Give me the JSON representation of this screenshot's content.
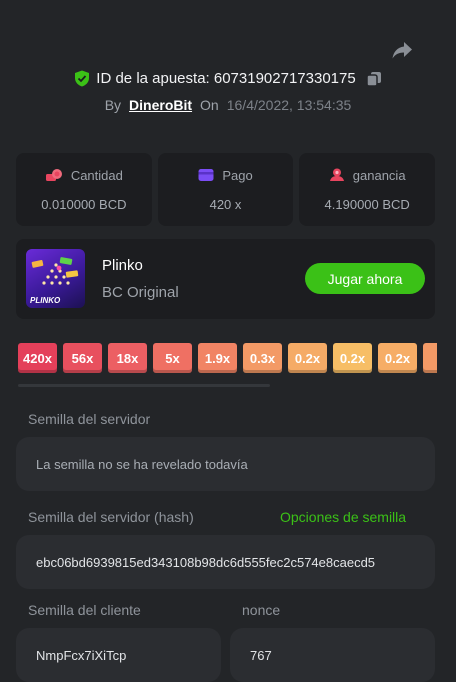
{
  "header": {
    "bet_label": "ID de la apuesta: 60731902717330175",
    "by_label": "By",
    "user": "DineroBit",
    "on_label": "On",
    "date": "16/4/2022, 13:54:35"
  },
  "stats": [
    {
      "label": "Cantidad",
      "value": "0.010000 BCD",
      "icon": "coins-icon",
      "icon_color": "#e8455f"
    },
    {
      "label": "Pago",
      "value": "420 x",
      "icon": "wallet-icon",
      "icon_color": "#7b4df5"
    },
    {
      "label": "ganancia",
      "value": "4.190000 BCD",
      "icon": "profit-icon",
      "icon_color": "#e8455f"
    }
  ],
  "game": {
    "name": "Plinko",
    "provider": "BC Original",
    "thumb_text": "PLINKO",
    "play_label": "Jugar ahora"
  },
  "multipliers": [
    {
      "label": "420x",
      "color": "#e4405a"
    },
    {
      "label": "56x",
      "color": "#e8505e"
    },
    {
      "label": "18x",
      "color": "#ec5f63"
    },
    {
      "label": "5x",
      "color": "#ef7063"
    },
    {
      "label": "1.9x",
      "color": "#f18464"
    },
    {
      "label": "0.3x",
      "color": "#f39a66"
    },
    {
      "label": "0.2x",
      "color": "#f5ab66"
    },
    {
      "label": "0.2x",
      "color": "#f7be66"
    },
    {
      "label": "0.2x",
      "color": "#f6ad66"
    },
    {
      "label": "",
      "color": "#f39a66"
    }
  ],
  "server_seed": {
    "label": "Semilla del servidor",
    "value": "La semilla no se ha revelado todavía"
  },
  "server_hash": {
    "label": "Semilla del servidor (hash)",
    "options_label": "Opciones de semilla",
    "value": "ebc06bd6939815ed343108b98dc6d555fec2c574e8caecd5"
  },
  "client_seed": {
    "label": "Semilla del cliente",
    "value": "NmpFcx7iXiTcp"
  },
  "nonce": {
    "label": "nonce",
    "value": "767"
  },
  "colors": {
    "accent": "#3bc117",
    "background": "#232528",
    "panel": "#1c1d20"
  }
}
